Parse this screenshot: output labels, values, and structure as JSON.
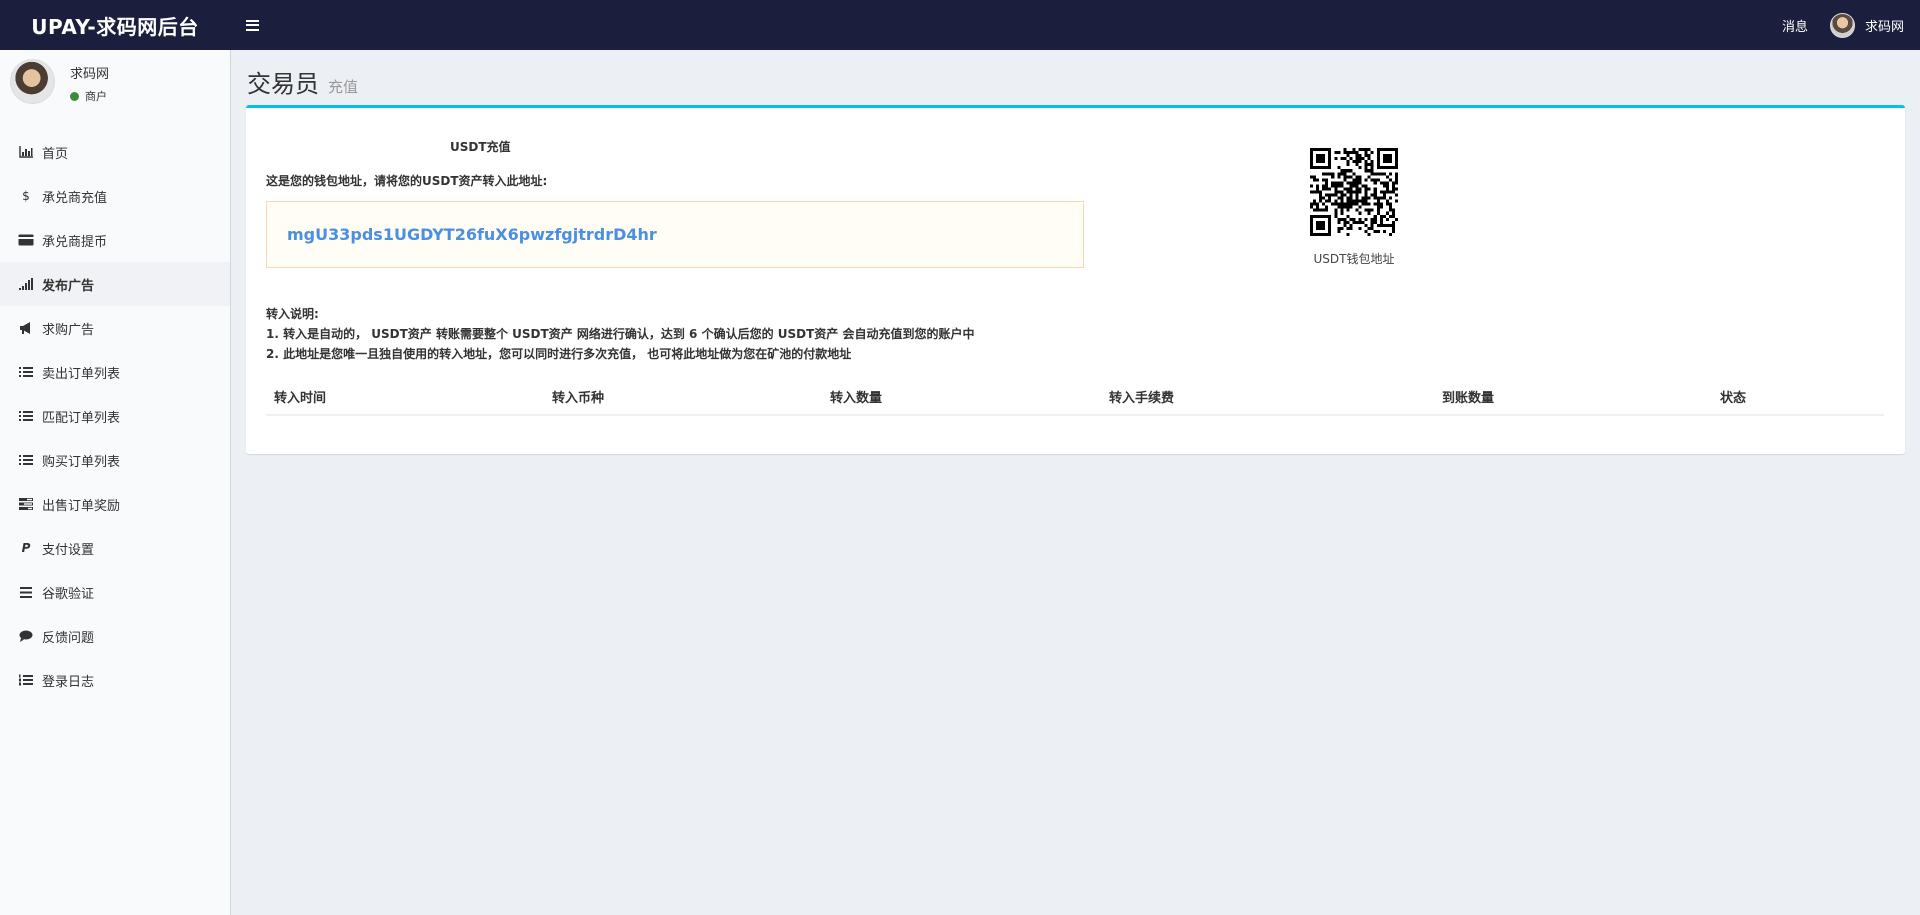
{
  "header": {
    "brand": "UPAY-求码网后台",
    "messages_label": "消息",
    "user_name": "求码网"
  },
  "sidebar": {
    "user": {
      "name": "求码网",
      "role": "商户",
      "status_color": "#3c8c3c"
    },
    "items": [
      {
        "label": "首页",
        "icon": "bar-chart-icon"
      },
      {
        "label": "承兑商充值",
        "icon": "dollar-icon"
      },
      {
        "label": "承兑商提币",
        "icon": "credit-card-icon"
      },
      {
        "label": "发布广告",
        "icon": "signal-icon",
        "active": true
      },
      {
        "label": "求购广告",
        "icon": "bullhorn-icon"
      },
      {
        "label": "卖出订单列表",
        "icon": "list-icon"
      },
      {
        "label": "匹配订单列表",
        "icon": "list-icon"
      },
      {
        "label": "购买订单列表",
        "icon": "list-icon"
      },
      {
        "label": "出售订单奖励",
        "icon": "tasks-icon"
      },
      {
        "label": "支付设置",
        "icon": "paypal-icon"
      },
      {
        "label": "谷歌验证",
        "icon": "bars-icon"
      },
      {
        "label": "反馈问题",
        "icon": "comment-icon"
      },
      {
        "label": "登录日志",
        "icon": "list-ol-icon"
      }
    ]
  },
  "page": {
    "title": "交易员",
    "subtitle": "充值"
  },
  "recharge": {
    "title": "USDT充值",
    "address_label": "这是您的钱包地址，请将您的USDT资产转入此地址:",
    "address": "mgU33pds1UGDYT26fuX6pwzfgjtrdrD4hr",
    "qr_caption": "USDT钱包地址",
    "instructions_title": "转入说明:",
    "instruction_1": "1. 转入是自动的， USDT资产 转账需要整个 USDT资产 网络进行确认，达到 6 个确认后您的 USDT资产 会自动充值到您的账户中",
    "instruction_2": "2. 此地址是您唯一且独自使用的转入地址，您可以同时进行多次充值， 也可将此地址做为您在矿池的付款地址"
  },
  "table": {
    "columns": [
      "转入时间",
      "转入币种",
      "转入数量",
      "转入手续费",
      "到账数量",
      "状态"
    ]
  },
  "colors": {
    "topbar": "#1b1e3d",
    "accent": "#00c0ef",
    "address_text": "#4a90e2"
  }
}
